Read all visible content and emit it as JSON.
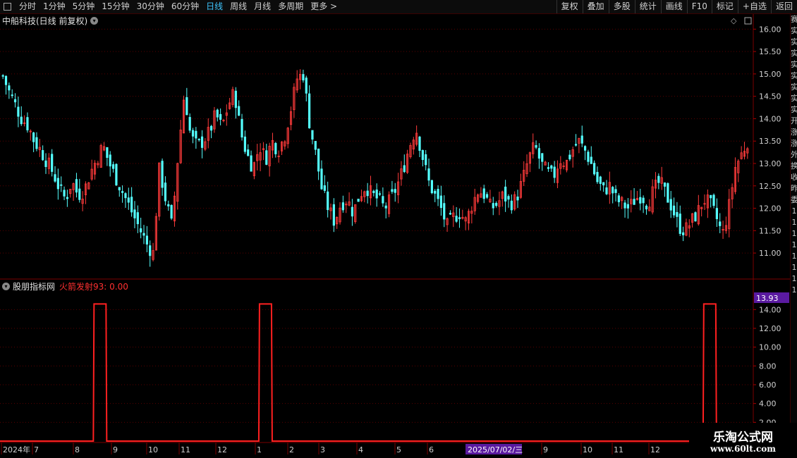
{
  "toolbar": {
    "periods": [
      "分时",
      "1分钟",
      "5分钟",
      "15分钟",
      "30分钟",
      "60分钟",
      "日线",
      "周线",
      "月线",
      "多周期",
      "更多 >"
    ],
    "active": "日线",
    "right": [
      "复权",
      "叠加",
      "多股",
      "统计",
      "画线",
      "F10",
      "标记",
      "+自选",
      "返回"
    ]
  },
  "main_title": "中船科技(日线 前复权)",
  "indicator": {
    "name": "股朋指标网",
    "value_text": "火箭发射93: 0.00",
    "current_value": "13.93"
  },
  "price_axis": [
    "16.00",
    "15.50",
    "15.00",
    "14.50",
    "14.00",
    "13.50",
    "13.00",
    "12.50",
    "12.00",
    "11.50",
    "11.00"
  ],
  "ind_axis": [
    "14.00",
    "12.00",
    "10.00",
    "8.00",
    "6.00",
    "4.00",
    "2.00"
  ],
  "dates": [
    "2024年",
    "7",
    "8",
    "9",
    "10",
    "11",
    "12",
    "1",
    "2",
    "3",
    "4",
    "5",
    "6",
    "9",
    "10",
    "11",
    "12"
  ],
  "crosshair_date": "2025/07/02/三",
  "side_chars": [
    "赛",
    "实",
    "实",
    "实",
    "实",
    "实",
    "实",
    "实",
    "实",
    "开",
    "涨",
    "涨",
    "外",
    "换",
    "收",
    "昨",
    "",
    "委",
    "1",
    "1",
    "1",
    "1",
    "1",
    "1",
    "1",
    "1"
  ],
  "watermark": {
    "line1": "乐淘公式网",
    "line2": "www.60lt.com"
  },
  "colors": {
    "up": "#ff3b3b",
    "down": "#54ffff",
    "line": "#ff2020",
    "grid": "#5a0000"
  },
  "chart_data": {
    "type": "candlestick",
    "title": "中船科技(日线 前复权)",
    "ylim": [
      10.75,
      16.1
    ],
    "close_series": [
      14.95,
      14.6,
      14.3,
      14.0,
      13.85,
      13.5,
      13.3,
      13.05,
      12.8,
      12.45,
      12.2,
      12.6,
      12.3,
      12.4,
      12.8,
      13.1,
      13.4,
      13.0,
      12.7,
      12.4,
      12.1,
      11.8,
      11.5,
      11.2,
      11.0,
      12.9,
      12.2,
      11.6,
      13.2,
      14.6,
      13.6,
      13.4,
      13.5,
      13.7,
      14.1,
      13.8,
      14.3,
      14.6,
      13.7,
      13.2,
      12.9,
      13.4,
      13.1,
      13.5,
      13.3,
      13.6,
      14.2,
      14.9,
      15.0,
      13.9,
      13.2,
      12.4,
      12.0,
      11.7,
      12.1,
      12.2,
      11.9,
      12.3,
      12.5,
      12.3,
      12.2,
      12.0,
      12.2,
      12.5,
      12.9,
      13.4,
      13.8,
      13.2,
      12.6,
      12.3,
      12.0,
      11.6,
      11.8,
      11.9,
      11.7,
      12.1,
      12.4,
      12.3,
      12.0,
      12.1,
      12.3,
      12.1,
      12.2,
      12.6,
      13.1,
      13.4,
      13.0,
      12.8,
      12.7,
      13.1,
      13.0,
      13.3,
      13.5,
      13.3,
      13.0,
      12.6,
      12.4,
      12.5,
      12.2,
      12.1,
      12.0,
      12.2,
      12.3,
      12.1,
      12.4,
      12.6,
      12.3,
      12.0,
      11.6,
      11.5,
      11.7,
      11.9,
      12.2,
      12.1,
      11.8,
      11.4,
      12.0,
      12.9,
      13.2,
      13.5
    ],
    "rocket_signal_days": [
      30,
      84,
      229
    ],
    "ind_ylim": [
      0,
      15
    ]
  }
}
